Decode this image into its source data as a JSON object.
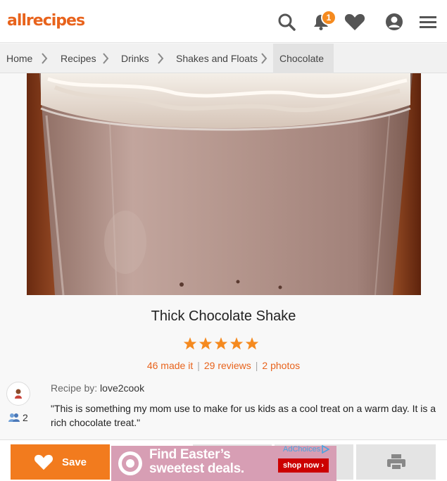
{
  "header": {
    "logo_text": "allrecipes",
    "notification_count": "1",
    "icons": [
      "search-icon",
      "bell-icon",
      "heart-icon",
      "profile-icon",
      "menu-icon"
    ]
  },
  "breadcrumb": {
    "items": [
      {
        "label": "Home"
      },
      {
        "label": "Recipes"
      },
      {
        "label": "Drinks"
      },
      {
        "label": "Shakes and Floats"
      },
      {
        "label": "Chocolate"
      }
    ]
  },
  "recipe": {
    "title": "Thick Chocolate Shake",
    "rating_stars": 5,
    "made_it": "46 made it",
    "reviews": "29 reviews",
    "photos": "2 photos",
    "byline_label": "Recipe by:",
    "author": "love2cook",
    "followers": "2",
    "description": "\"This is something my mom use to make for us kids as a cool treat on a warm day. It is a rich chocolate treat.\""
  },
  "actions": {
    "save_label": "Save"
  },
  "ad": {
    "headline_line1": "Find Easter’s",
    "headline_line2": "sweetest deals.",
    "cta": "shop now ›",
    "adchoices": "AdChoices"
  },
  "colors": {
    "brand_orange": "#e8631c",
    "star_orange": "#f58a1f",
    "save_orange": "#f27b1e"
  }
}
